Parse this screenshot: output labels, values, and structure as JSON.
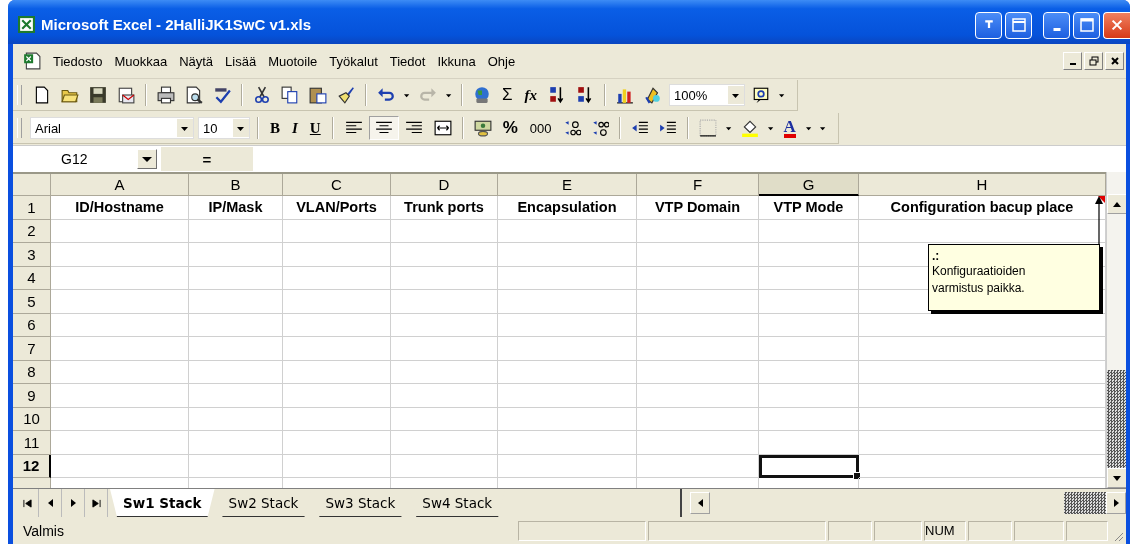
{
  "window": {
    "title": "Microsoft Excel - 2HalliJK1SwC v1.xls"
  },
  "menu_bar": [
    {
      "label": "Tiedosto"
    },
    {
      "label": "Muokkaa"
    },
    {
      "label": "Näytä"
    },
    {
      "label": "Lisää"
    },
    {
      "label": "Muotoile"
    },
    {
      "label": "Työkalut"
    },
    {
      "label": "Tiedot"
    },
    {
      "label": "Ikkuna"
    },
    {
      "label": "Ohje"
    }
  ],
  "standard_toolbar": {
    "autosum": "Σ",
    "function": "fx",
    "zoom": "100%"
  },
  "formatting_toolbar": {
    "font": "Arial",
    "size": "10",
    "bold": "B",
    "italic": "I",
    "underline": "U",
    "alignment_buttons": [
      {
        "kind": "left",
        "selected": false
      },
      {
        "kind": "center",
        "selected": true
      },
      {
        "kind": "right",
        "selected": false
      }
    ],
    "percent": "%",
    "thousands": "000",
    "font_color": "A"
  },
  "formula_bar": {
    "name_box": "G12",
    "equals": "="
  },
  "columns": [
    {
      "letter": "A",
      "heading": "ID/Hostname",
      "selected": false
    },
    {
      "letter": "B",
      "heading": "IP/Mask",
      "selected": false
    },
    {
      "letter": "C",
      "heading": "VLAN/Ports",
      "selected": false
    },
    {
      "letter": "D",
      "heading": "Trunk ports",
      "selected": false
    },
    {
      "letter": "E",
      "heading": "Encapsulation",
      "selected": false
    },
    {
      "letter": "F",
      "heading": "VTP Domain",
      "selected": false
    },
    {
      "letter": "G",
      "heading": "VTP Mode",
      "selected": true
    },
    {
      "letter": "H",
      "heading": "Configuration bacup place",
      "selected": false
    }
  ],
  "rows": [
    {
      "label": "1",
      "selected": false
    },
    {
      "label": "2",
      "selected": false
    },
    {
      "label": "3",
      "selected": false
    },
    {
      "label": "4",
      "selected": false
    },
    {
      "label": "5",
      "selected": false
    },
    {
      "label": "6",
      "selected": false
    },
    {
      "label": "7",
      "selected": false
    },
    {
      "label": "8",
      "selected": false
    },
    {
      "label": "9",
      "selected": false
    },
    {
      "label": "10",
      "selected": false
    },
    {
      "label": "11",
      "selected": false
    },
    {
      "label": "12",
      "selected": true
    }
  ],
  "comment": {
    "author": ".:",
    "text": "Konfiguraatioiden varmistus paikka."
  },
  "sheet_tabs": [
    {
      "label": "Sw1 Stack",
      "selected": true
    },
    {
      "label": "Sw2 Stack",
      "selected": false
    },
    {
      "label": "Sw3 Stack",
      "selected": false
    },
    {
      "label": "Sw4 Stack",
      "selected": false
    }
  ],
  "status_bar": {
    "text": "Valmis",
    "indicators": [
      {
        "kind": "empty"
      },
      {
        "kind": "empty"
      },
      {
        "kind": "empty"
      },
      {
        "kind": "empty"
      },
      {
        "kind": "text",
        "label": "NUM"
      },
      {
        "kind": "empty"
      },
      {
        "kind": "empty"
      },
      {
        "kind": "empty"
      }
    ]
  }
}
